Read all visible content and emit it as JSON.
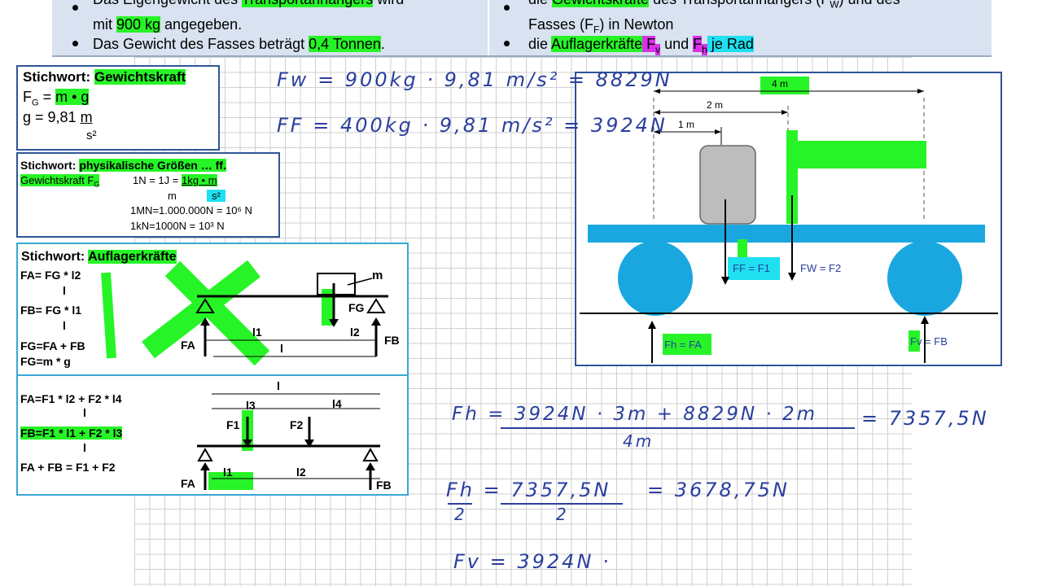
{
  "task": {
    "left": {
      "line1a": "Das Eigengewicht des ",
      "line1b": "Transportanhängers",
      "line1c": " wird",
      "line2a": "mit ",
      "line2b": "900 kg",
      "line2c": " angegeben.",
      "line3a": "Das Gewicht des Fasses beträgt ",
      "line3b": "0,4 Tonnen",
      "line3c": "."
    },
    "right": {
      "line1a": "die ",
      "line1b": "Gewichtskräfte",
      "line1c": " des Transportanhängers (F",
      "line1d": "W",
      "line1e": ") und des",
      "line2a": "Fasses (F",
      "line2b": "F",
      "line2c": ") in Newton",
      "line3a": "die ",
      "line3b": "Auflagerkräfte",
      "line3c": " F",
      "line3d": "v",
      "line3e": " und ",
      "line3f": "F",
      "line3g": "h",
      "line3h": " je Rad"
    }
  },
  "box1": {
    "title_a": "Stichwort: ",
    "title_b": "Gewichtskraft",
    "f1a": "F",
    "f1b": "G",
    "f1c": " = ",
    "f1d": "m • g",
    "f2a": "g = 9,81 ",
    "f2b": "m",
    "f2c": "s²"
  },
  "box2": {
    "title_a": "Stichwort: ",
    "title_b": "physikalische Größen … ff.",
    "row1a": "Gewichtskraft  F",
    "row1b": "G",
    "row1c": "1N = 1J = ",
    "row1d": "1kg • m",
    "row1e": "m",
    "row1f": "s²",
    "row2": "1MN=1.000.000N = 10⁶ N",
    "row3": "1kN=1000N = 10³ N"
  },
  "box3": {
    "title_a": "Stichwort: ",
    "title_b": "Auflagerkräfte",
    "fa": "FA= FG * l2",
    "fa_den": "l",
    "fb": "FB= FG * l1",
    "fb_den": "l",
    "fg1": "FG=FA + FB",
    "fg2": "FG=m * g",
    "m": "m",
    "fg": "FG",
    "fa_lbl": "FA",
    "fb_lbl": "FB",
    "l1": "l1",
    "l2": "l2",
    "l": "l"
  },
  "box4": {
    "fa": "FA=F1 * l2 + F2 * l4",
    "fa_den": "l",
    "fb": "FB=F1 * l1 + F2 * l3",
    "fb_den": "l",
    "sum": "FA + FB = F1 + F2",
    "l": "l",
    "l3": "l3",
    "l4": "l4",
    "f1": "F1",
    "f2": "F2",
    "l1": "l1",
    "l2": "l2",
    "fa_lbl": "FA",
    "fb_lbl": "FB"
  },
  "box5": {
    "d4": "4 m",
    "d2": "2 m",
    "d1": "1 m",
    "ff": "FF = F1",
    "fw": "FW = F2",
    "fh": "Fh = FA",
    "fv": "Fv = FB"
  },
  "handwriting": {
    "fw": "Fw = 900kg · 9,81 m/s² = 8829N",
    "ff": "FF = 400kg · 9,81 m/s² = 3924N",
    "eq1_num": "Fh = 3924N · 3m + 8829N · 2m",
    "eq1_den": "4m",
    "eq1_res": "= 7357,5N",
    "eq2_num": "Fh = 7357,5N",
    "eq2_den1": "2",
    "eq2_den2": "2",
    "eq2_res": "= 3678,75N",
    "eq3": "Fv = 3924N ·"
  },
  "colors": {
    "highlight_green": "#27f427",
    "highlight_cyan": "#1ee0f0",
    "highlight_magenta": "#d832e8",
    "ink_blue": "#2a3f9e",
    "wheel": "#1aa7e0"
  }
}
